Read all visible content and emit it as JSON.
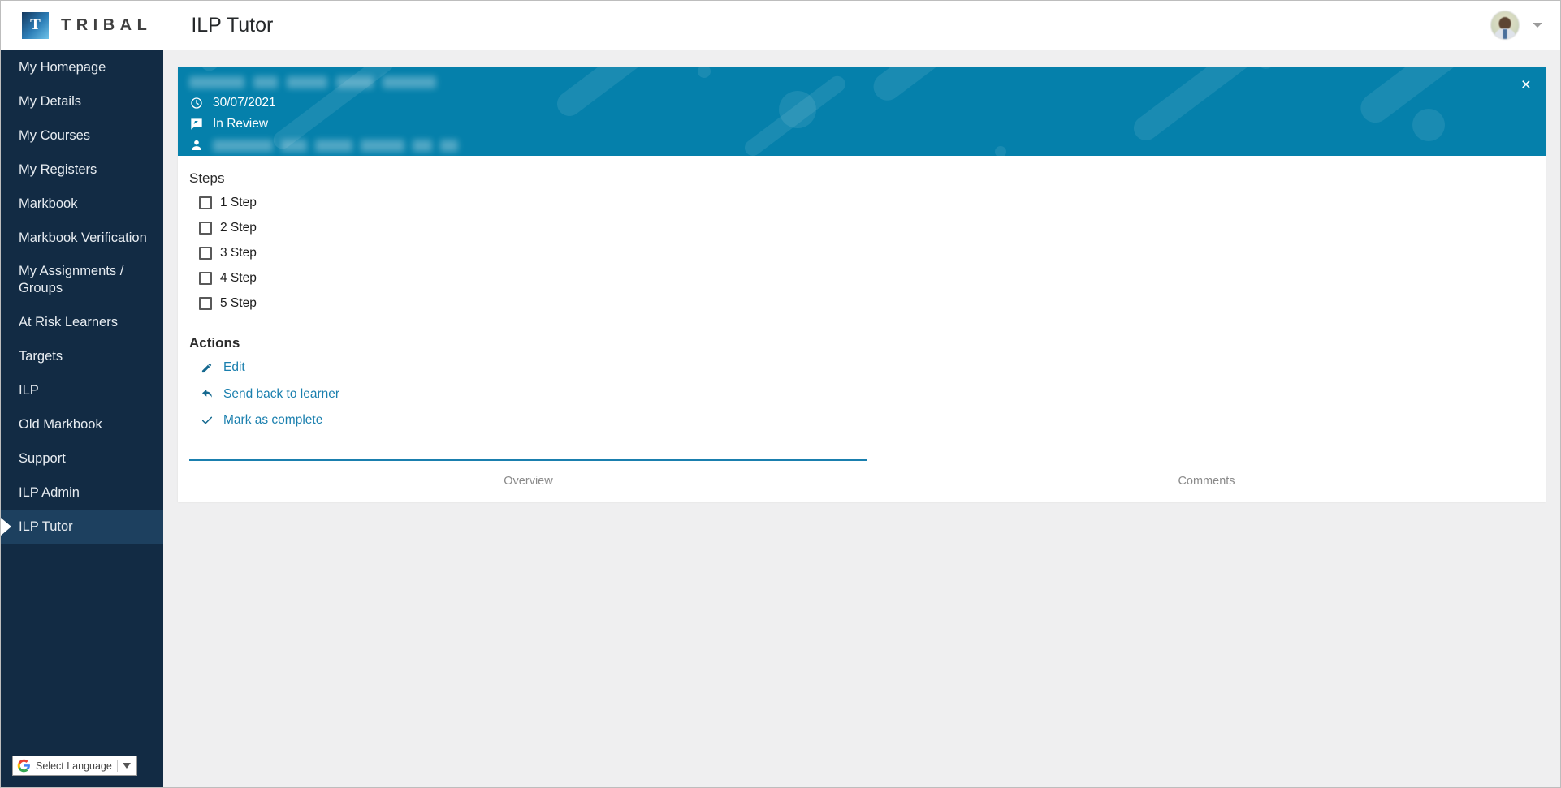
{
  "header": {
    "logo_letter": "T",
    "brand": "TRIBAL",
    "app_title": "ILP Tutor"
  },
  "sidebar": {
    "items": [
      {
        "label": "My Homepage",
        "active": false
      },
      {
        "label": "My Details",
        "active": false
      },
      {
        "label": "My Courses",
        "active": false
      },
      {
        "label": "My Registers",
        "active": false
      },
      {
        "label": "Markbook",
        "active": false
      },
      {
        "label": "Markbook Verification",
        "active": false
      },
      {
        "label": "My Assignments / Groups",
        "active": false
      },
      {
        "label": "At Risk Learners",
        "active": false
      },
      {
        "label": "Targets",
        "active": false
      },
      {
        "label": "ILP",
        "active": false
      },
      {
        "label": "Old Markbook",
        "active": false
      },
      {
        "label": "Support",
        "active": false
      },
      {
        "label": "ILP Admin",
        "active": false
      },
      {
        "label": "ILP Tutor",
        "active": true
      }
    ],
    "translate": {
      "label": "Select Language"
    }
  },
  "banner": {
    "title_redacted": true,
    "date": "30/07/2021",
    "status": "In Review",
    "learner_redacted": true,
    "close_label": "×",
    "background_color": "#0580ab"
  },
  "steps": {
    "title": "Steps",
    "items": [
      {
        "label": "1 Step",
        "checked": false
      },
      {
        "label": "2 Step",
        "checked": false
      },
      {
        "label": "3 Step",
        "checked": false
      },
      {
        "label": "4 Step",
        "checked": false
      },
      {
        "label": "5 Step",
        "checked": false
      }
    ]
  },
  "actions": {
    "title": "Actions",
    "items": [
      {
        "label": "Edit",
        "icon": "pencil-icon"
      },
      {
        "label": "Send back to learner",
        "icon": "reply-arrow-icon"
      },
      {
        "label": "Mark as complete",
        "icon": "check-icon"
      }
    ]
  },
  "tabs": [
    {
      "label": "Overview",
      "active": true
    },
    {
      "label": "Comments",
      "active": false
    }
  ],
  "colors": {
    "accent": "#1a7fae",
    "banner": "#0580ab",
    "sidebar": "#122b44",
    "sidebar_active": "#1d405f",
    "page_bg": "#efeff0"
  }
}
